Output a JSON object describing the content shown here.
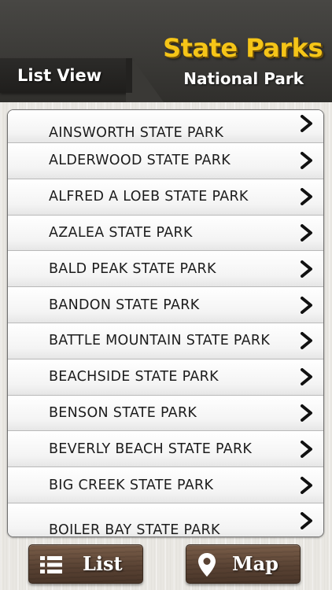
{
  "header": {
    "title": "State Parks",
    "subtitle": "National Park",
    "view_tab_label": "List View"
  },
  "parks": [
    {
      "name": "AINSWORTH STATE PARK",
      "icon": "chevron-right-icon"
    },
    {
      "name": "ALDERWOOD STATE PARK",
      "icon": "chevron-right-icon"
    },
    {
      "name": "ALFRED A LOEB STATE PARK",
      "icon": "chevron-right-icon"
    },
    {
      "name": "AZALEA STATE PARK",
      "icon": "chevron-right-icon"
    },
    {
      "name": "BALD PEAK STATE PARK",
      "icon": "chevron-right-icon"
    },
    {
      "name": "BANDON STATE PARK",
      "icon": "chevron-right-icon"
    },
    {
      "name": "BATTLE MOUNTAIN STATE PARK",
      "icon": "chevron-right-icon"
    },
    {
      "name": "BEACHSIDE STATE PARK",
      "icon": "chevron-right-icon"
    },
    {
      "name": "BENSON STATE PARK",
      "icon": "chevron-right-icon"
    },
    {
      "name": "BEVERLY BEACH STATE PARK",
      "icon": "chevron-right-icon"
    },
    {
      "name": "BIG CREEK STATE PARK",
      "icon": "chevron-right-icon"
    },
    {
      "name": "BOILER BAY STATE PARK",
      "icon": "chevron-right-icon"
    }
  ],
  "bottom_bar": {
    "list_label": "List",
    "list_icon": "list-icon",
    "map_label": "Map",
    "map_icon": "map-pin-icon"
  },
  "colors": {
    "title": "#f5c518",
    "header_bg": "#3b3a37",
    "tab_bg": "#262523",
    "button_wood": "#5a4334"
  }
}
